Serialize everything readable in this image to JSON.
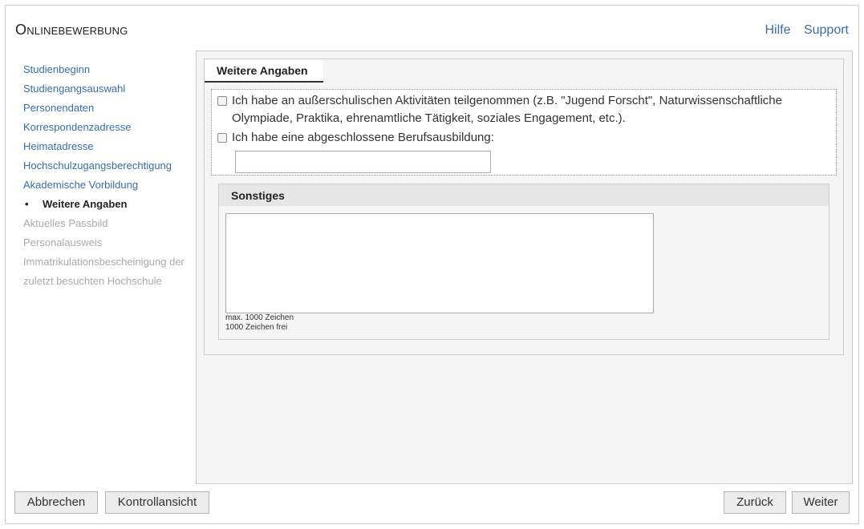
{
  "header": {
    "app_title": "Onlinebewerbung",
    "links": {
      "hilfe": "Hilfe",
      "support": "Support"
    }
  },
  "sidebar": {
    "items": [
      {
        "label": "Studienbeginn",
        "state": "link"
      },
      {
        "label": "Studiengangsauswahl",
        "state": "link"
      },
      {
        "label": "Personendaten",
        "state": "link"
      },
      {
        "label": "Korrespondenzadresse",
        "state": "link"
      },
      {
        "label": "Heimatadresse",
        "state": "link"
      },
      {
        "label": "Hochschulzugangsberechtigung",
        "state": "link"
      },
      {
        "label": "Akademische Vorbildung",
        "state": "link"
      },
      {
        "label": "Weitere Angaben",
        "state": "active",
        "bullet": "•"
      },
      {
        "label": "Aktuelles Passbild",
        "state": "disabled"
      },
      {
        "label": "Personalausweis",
        "state": "disabled"
      },
      {
        "label": "Immatrikulationsbescheinigung der zuletzt besuchten Hochschule",
        "state": "disabled"
      }
    ]
  },
  "main": {
    "tab_label": "Weitere Angaben",
    "checkboxes": [
      {
        "label": "Ich habe an außerschulischen Aktivitäten teilgenommen (z.B. \"Jugend Forscht\", Naturwissenschaftliche Olympiade, Praktika, ehrenamtliche Tätigkeit, soziales Engagement, etc.).",
        "checked": false
      },
      {
        "label": "Ich habe eine abgeschlossene Berufsausbildung:",
        "checked": false
      }
    ],
    "berufsausbildung_value": "",
    "sonstiges": {
      "title": "Sonstiges",
      "value": "",
      "max_hint": "max. 1000 Zeichen",
      "remaining_hint": "1000 Zeichen frei"
    }
  },
  "footer": {
    "abbrechen": "Abbrechen",
    "kontrollansicht": "Kontrollansicht",
    "zurueck": "Zurück",
    "weiter": "Weiter"
  }
}
